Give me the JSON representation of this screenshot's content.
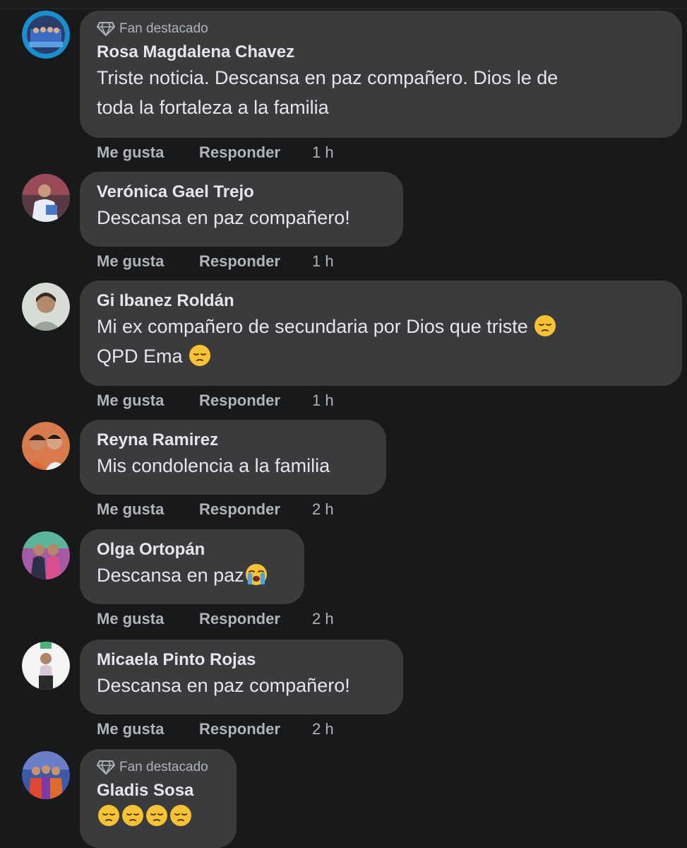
{
  "comments": [
    {
      "badge": "Fan destacado",
      "author": "Rosa Magdalena Chavez",
      "lines": [
        "Triste noticia. Descansa en paz compañero. Dios le de",
        "toda la fortaleza a la familia"
      ],
      "like": "Me gusta",
      "reply": "Responder",
      "time": "1 h",
      "avatar_color": "#1d6fb8"
    },
    {
      "author": "Verónica Gael Trejo",
      "lines": [
        "Descansa en paz compañero!"
      ],
      "like": "Me gusta",
      "reply": "Responder",
      "time": "1 h",
      "avatar_color": "#7a4b52"
    },
    {
      "author": "Gi Ibanez Roldán",
      "lines": [
        "Mi ex compañero de secundaria por Dios que triste",
        "QPD Ema"
      ],
      "like": "Me gusta",
      "reply": "Responder",
      "time": "1 h",
      "avatar_color": "#c9cfc7"
    },
    {
      "author": "Reyna Ramirez",
      "lines": [
        "Mis condolencia a la familia"
      ],
      "like": "Me gusta",
      "reply": "Responder",
      "time": "2 h",
      "avatar_color": "#b5643f"
    },
    {
      "author": "Olga Ortopán",
      "lines": [
        "Descansa en paz"
      ],
      "like": "Me gusta",
      "reply": "Responder",
      "time": "2 h",
      "avatar_color": "#8e4f8f"
    },
    {
      "author": "Micaela Pinto Rojas",
      "lines": [
        "Descansa en paz compañero!"
      ],
      "like": "Me gusta",
      "reply": "Responder",
      "time": "2 h",
      "avatar_color": "#e8e8e8"
    },
    {
      "badge": "Fan destacado",
      "author": "Gladis Sosa",
      "lines": [
        ""
      ],
      "avatar_color": "#3b5aa8"
    }
  ],
  "icons": {
    "fan_badge": "diamond-icon",
    "pensive": "pensive-face-emoji",
    "crying": "loudly-crying-face-emoji"
  }
}
